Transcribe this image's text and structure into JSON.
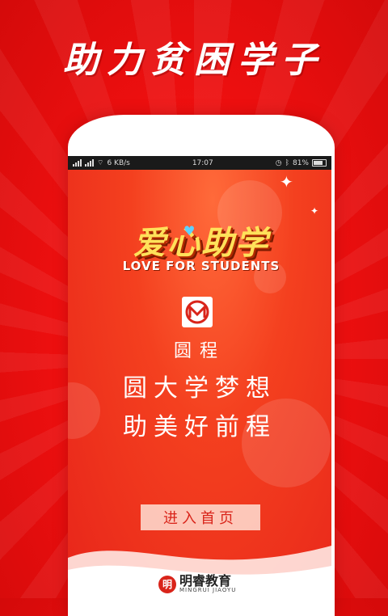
{
  "promo": {
    "title": "助力贫困学子"
  },
  "statusbar": {
    "carrier": "",
    "speed": "6 KB/s",
    "time": "17:07",
    "battery": "81%"
  },
  "splash": {
    "logo_cn": "爱心助学",
    "logo_en": "LOVE FOR STUDENTS",
    "brand_name": "圆程",
    "slogan_line1": "圆大学梦想",
    "slogan_line2": "助美好前程",
    "enter_button": "进入首页"
  },
  "footer": {
    "company_cn": "明睿教育",
    "company_en": "MINGRUI JIAOYU"
  },
  "icons": [
    "signal-icon",
    "wifi-icon",
    "alarm-icon",
    "bluetooth-icon",
    "battery-icon",
    "heart-icon",
    "brand-m-icon",
    "seal-icon"
  ],
  "colors": {
    "accent": "#e8251a",
    "logo_yellow": "#ffe15a"
  }
}
